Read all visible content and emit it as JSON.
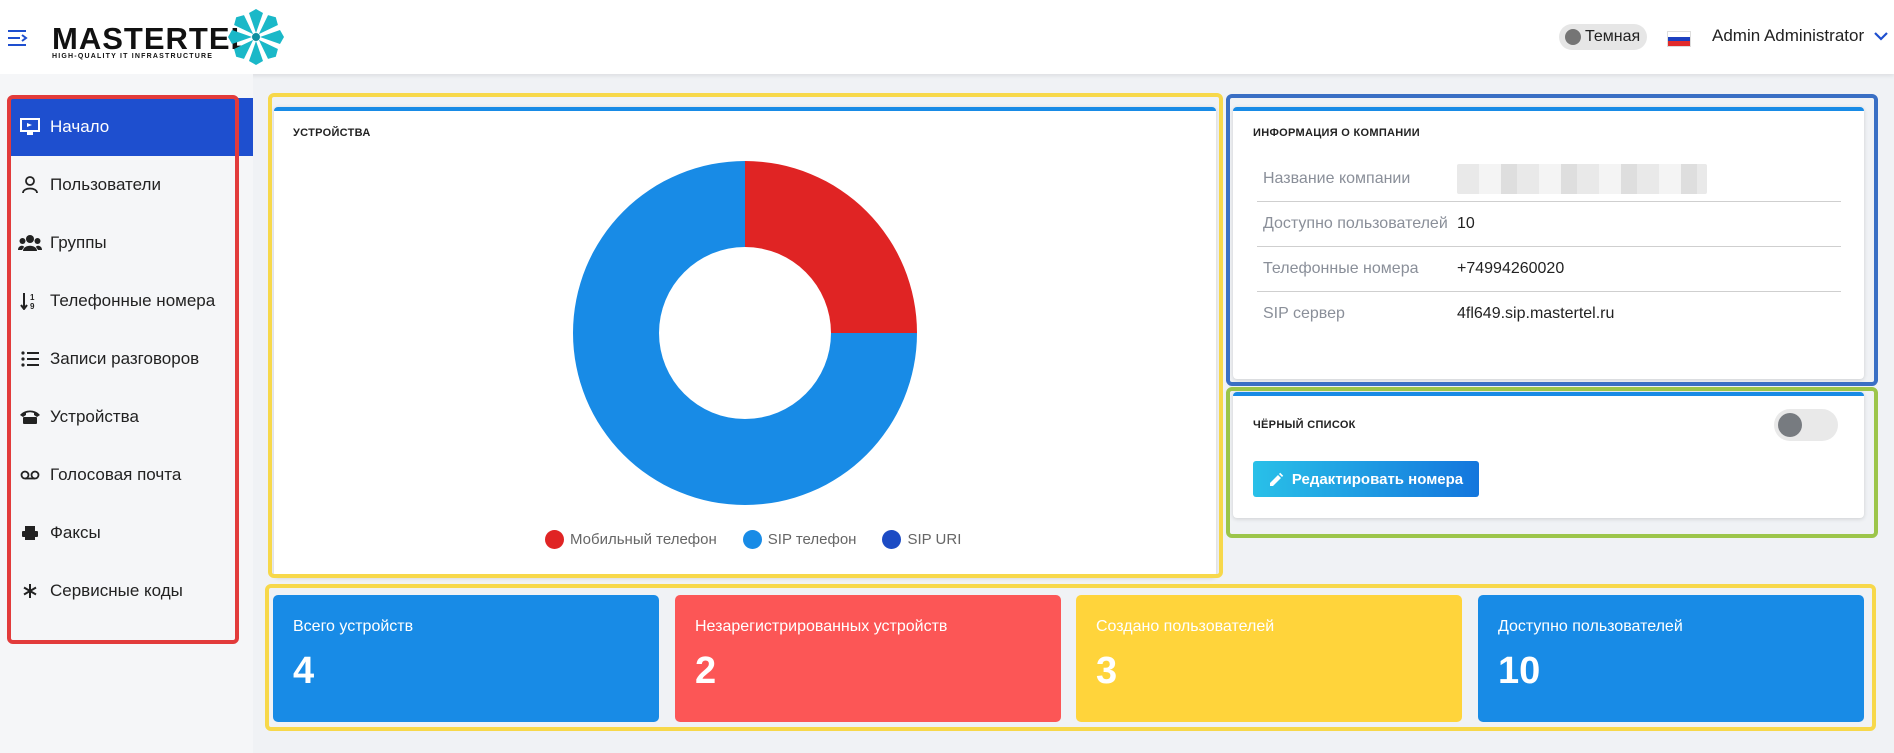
{
  "header": {
    "brand": "MASTERTEL",
    "tagline": "HIGH-QUALITY IT INFRASTRUCTURE",
    "theme_label": "Темная",
    "user_name": "Admin Administrator",
    "flag_colors": [
      "#ffffff",
      "#1c3fbf",
      "#e22b2b"
    ]
  },
  "sidebar": {
    "items": [
      {
        "label": "Начало",
        "icon": "monitor-icon",
        "active": true
      },
      {
        "label": "Пользователи",
        "icon": "user-icon"
      },
      {
        "label": "Группы",
        "icon": "group-icon"
      },
      {
        "label": "Телефонные номера",
        "icon": "sort-numbers-icon"
      },
      {
        "label": "Записи разговоров",
        "icon": "list-icon"
      },
      {
        "label": "Устройства",
        "icon": "phone-icon"
      },
      {
        "label": "Голосовая почта",
        "icon": "voicemail-icon"
      },
      {
        "label": "Факсы",
        "icon": "fax-icon"
      },
      {
        "label": "Сервисные коды",
        "icon": "asterisk-icon"
      }
    ]
  },
  "devices_panel": {
    "title": "УСТРОЙСТВА",
    "legend": [
      {
        "label": "Мобильный телефон",
        "color": "#e02424"
      },
      {
        "label": "SIP телефон",
        "color": "#188be6"
      },
      {
        "label": "SIP URI",
        "color": "#1c4bc4"
      }
    ]
  },
  "chart_data": {
    "type": "pie",
    "donut": true,
    "title": "",
    "categories": [
      "Мобильный телефон",
      "SIP телефон",
      "SIP URI"
    ],
    "values": [
      1,
      3,
      0
    ],
    "colors": [
      "#e02424",
      "#188be6",
      "#1c4bc4"
    ],
    "legend_position": "bottom"
  },
  "company": {
    "title": "ИНФОРМАЦИЯ О КОМПАНИИ",
    "rows": [
      {
        "key": "Название компании",
        "value": ""
      },
      {
        "key": "Доступно пользователей",
        "value": "10"
      },
      {
        "key": "Телефонные номера",
        "value": "+74994260020"
      },
      {
        "key": "SIP сервер",
        "value": "4fl649.sip.mastertel.ru"
      }
    ]
  },
  "blacklist": {
    "title": "ЧЁРНЫЙ СПИСОК",
    "button_label": "Редактировать номера",
    "enabled": false
  },
  "stats": [
    {
      "label": "Всего устройств",
      "value": "4",
      "color": "#188be6"
    },
    {
      "label": "Незарегистрированных устройств",
      "value": "2",
      "color": "#fc5656"
    },
    {
      "label": "Создано пользователей",
      "value": "3",
      "color": "#ffd43b"
    },
    {
      "label": "Доступно пользователей",
      "value": "10",
      "color": "#188be6"
    }
  ],
  "outline_colors": {
    "sidebar": "#e23b3b",
    "devices": "#f7d84a",
    "company": "#3a6fc4",
    "blacklist": "#9cc54a",
    "stats": "#f7d84a"
  }
}
